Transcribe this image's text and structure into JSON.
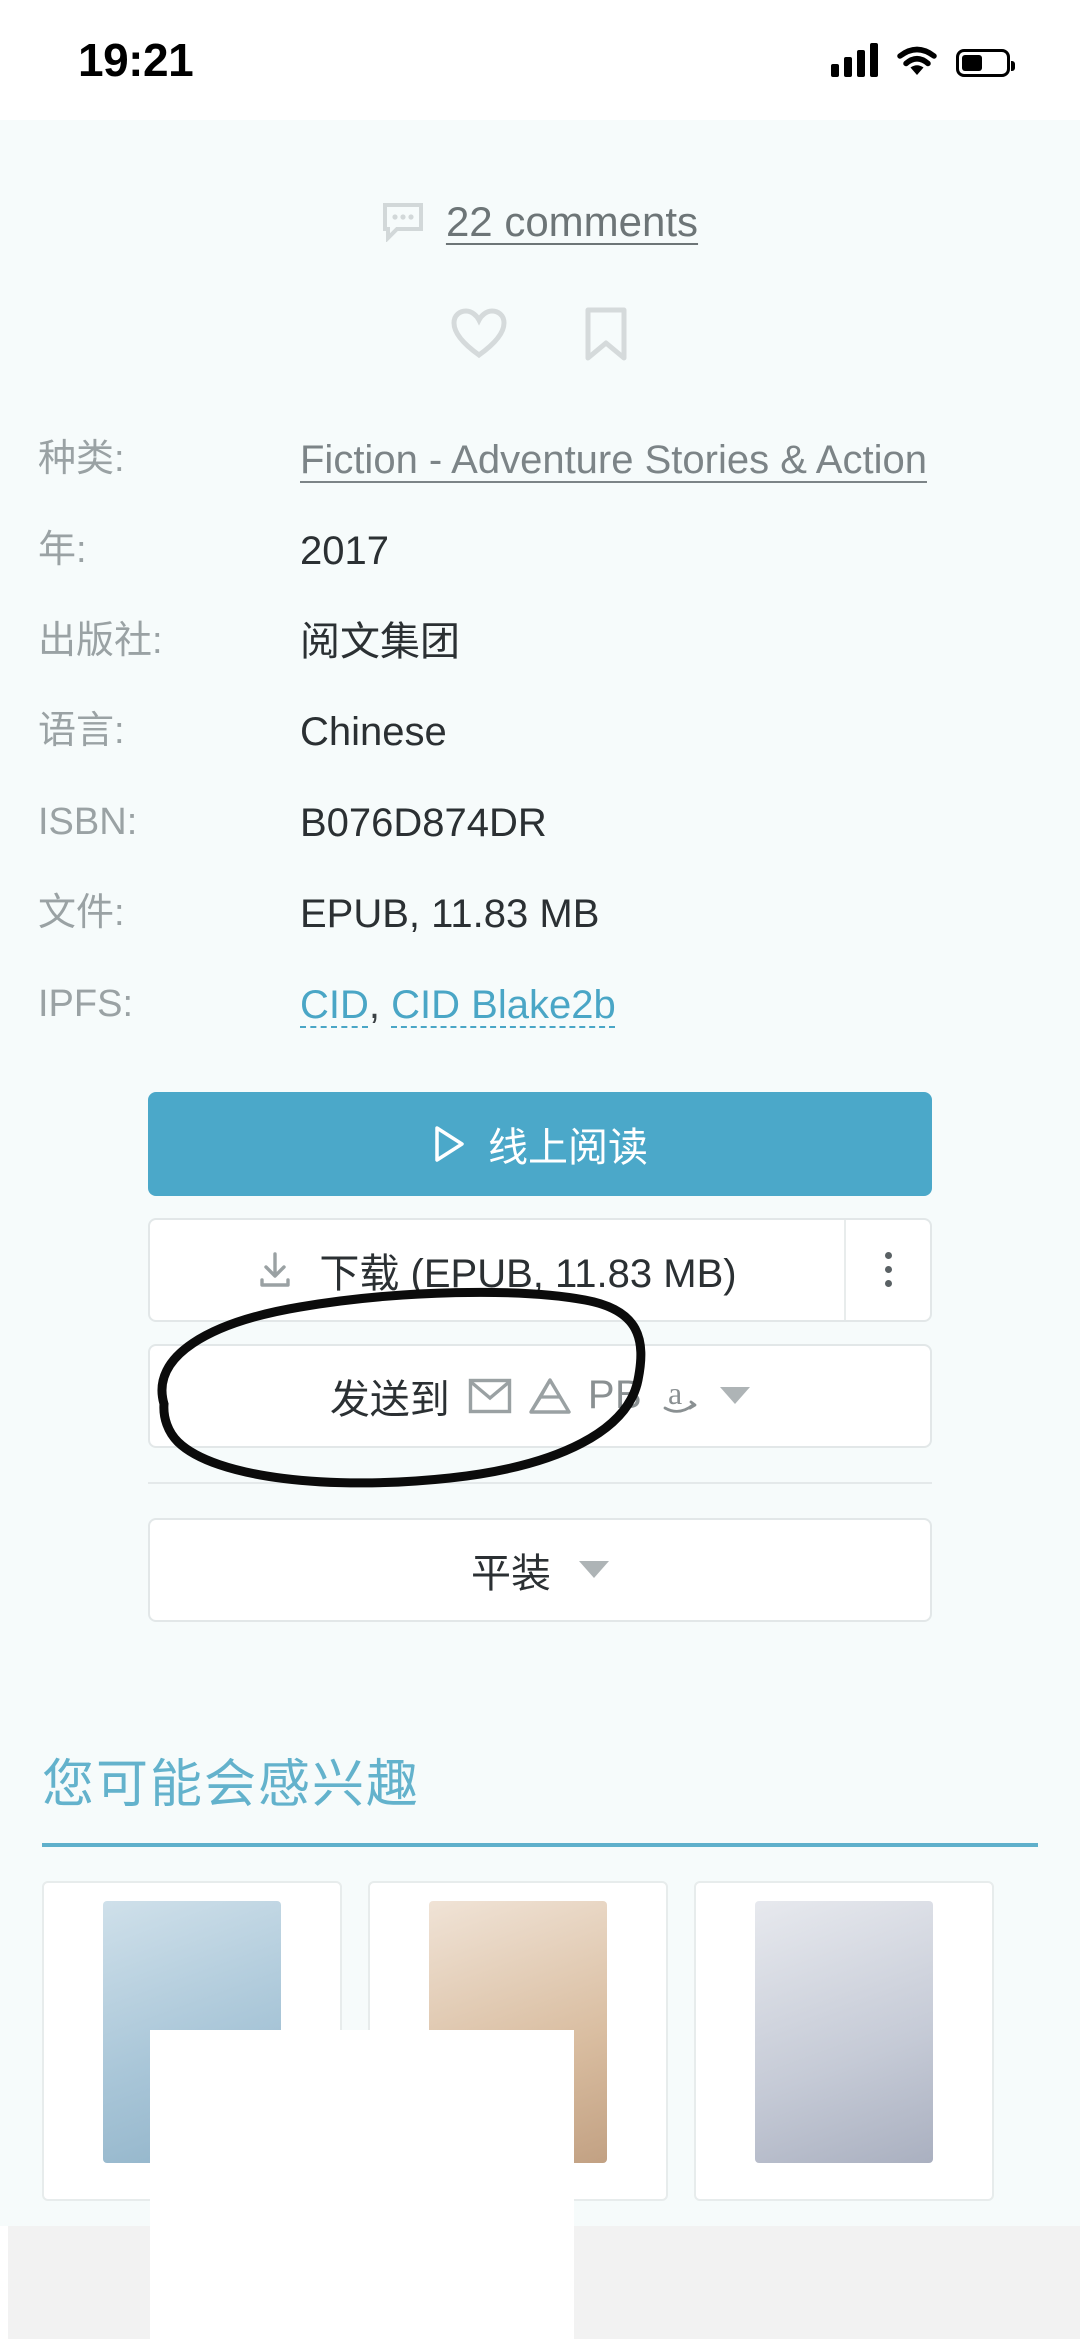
{
  "status_bar": {
    "time": "19:21",
    "signal_icon": "cellular-signal-icon",
    "wifi_icon": "wifi-icon",
    "battery_icon": "battery-icon"
  },
  "comments": {
    "icon": "comment-bubble-icon",
    "label": "22 comments",
    "count": 22
  },
  "actions": {
    "favorite_icon": "heart-outline-icon",
    "bookmark_icon": "bookmark-outline-icon"
  },
  "metadata": [
    {
      "label": "种类:",
      "value": "Fiction - Adventure Stories & Action",
      "type": "link"
    },
    {
      "label": "年:",
      "value": "2017",
      "type": "text"
    },
    {
      "label": "出版社:",
      "value": "阅文集团",
      "type": "text"
    },
    {
      "label": "语言:",
      "value": "Chinese",
      "type": "text"
    },
    {
      "label": "ISBN:",
      "value": "B076D874DR",
      "type": "text"
    },
    {
      "label": "文件:",
      "value": "EPUB, 11.83 MB",
      "type": "text"
    },
    {
      "label": "IPFS:",
      "value": "CID , CID Blake2b",
      "type": "links"
    }
  ],
  "meta_labels": {
    "genre": "种类:",
    "year": "年:",
    "publisher": "出版社:",
    "language": "语言:",
    "isbn": "ISBN:",
    "file": "文件:",
    "ipfs": "IPFS:"
  },
  "meta_values": {
    "genre": "Fiction - Adventure Stories & Action",
    "year": "2017",
    "publisher": "阅文集团",
    "language": "Chinese",
    "isbn": "B076D874DR",
    "file": "EPUB, 11.83 MB",
    "cid": "CID",
    "cid_separator": ",",
    "cid_blake2b": "CID Blake2b"
  },
  "buttons": {
    "read_online": {
      "label": "线上阅读",
      "icon": "play-triangle-icon"
    },
    "download": {
      "label": "下载 (EPUB, 11.83 MB)",
      "icon": "download-icon",
      "menu_icon": "kebab-menu-icon"
    },
    "send_to": {
      "label": "发送到",
      "targets": [
        "email-icon",
        "google-drive-icon",
        "PB",
        "amazon-icon"
      ],
      "pb_label": "PB",
      "caret_icon": "chevron-down-icon"
    },
    "format": {
      "label": "平装",
      "caret_icon": "chevron-down-icon"
    }
  },
  "recommendations": {
    "title": "您可能会感兴趣",
    "accent_color": "#5fb0cb"
  },
  "annotation": {
    "type": "hand-drawn-ellipse",
    "color": "#000000",
    "targets": "download-button"
  },
  "colors": {
    "page_background": "#f6fbfb",
    "primary_blue": "#4ba8c9",
    "link_blue": "#4aa6c6",
    "label_gray": "#9aa2a4",
    "value_dark": "#2b3033"
  }
}
